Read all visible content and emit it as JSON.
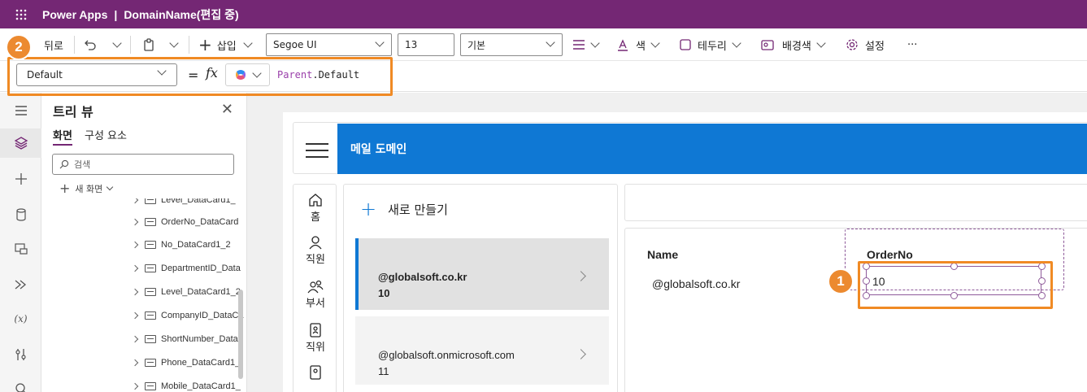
{
  "titlebar": {
    "app": "Power Apps",
    "separator": "|",
    "doc": "DomainName(편집 중)"
  },
  "command_bar": {
    "back": "뒤로",
    "insert": "삽입",
    "font": "Segoe UI",
    "font_size": "13",
    "font_weight": "기본",
    "color": "색",
    "border": "테두리",
    "fill": "배경색",
    "settings": "설정",
    "more": "···"
  },
  "formula_bar": {
    "property": "Default",
    "equals": "=",
    "fx": "fx",
    "formula_key": "Parent",
    "formula_rest": ".Default"
  },
  "callouts": {
    "one": "1",
    "two": "2"
  },
  "tree": {
    "title": "트리 뷰",
    "tab_screens": "화면",
    "tab_components": "구성 요소",
    "search_placeholder": "검색",
    "new_screen": "새 화면",
    "items": [
      "Level_DataCard1_",
      "OrderNo_DataCard",
      "No_DataCard1_2",
      "DepartmentID_Data",
      "Level_DataCard1_2",
      "CompanyID_DataCa",
      "ShortNumber_Data",
      "Phone_DataCard1_",
      "Mobile_DataCard1_"
    ]
  },
  "app": {
    "header_title": "메일 도메인",
    "nav": {
      "home": "홈",
      "employee": "직원",
      "department": "부서",
      "position": "직위"
    },
    "new_button": "새로 만들기",
    "list": [
      {
        "title": "@globalsoft.co.kr",
        "sub": "10"
      },
      {
        "title": "@globalsoft.onmicrosoft.com",
        "sub": "11"
      }
    ],
    "detail": {
      "name_label": "Name",
      "name_value": "@globalsoft.co.kr",
      "orderno_label": "OrderNo",
      "orderno_value": "10"
    }
  },
  "colors": {
    "brand": "#742774",
    "accent": "#0f78d4",
    "callout": "#f08a24"
  }
}
